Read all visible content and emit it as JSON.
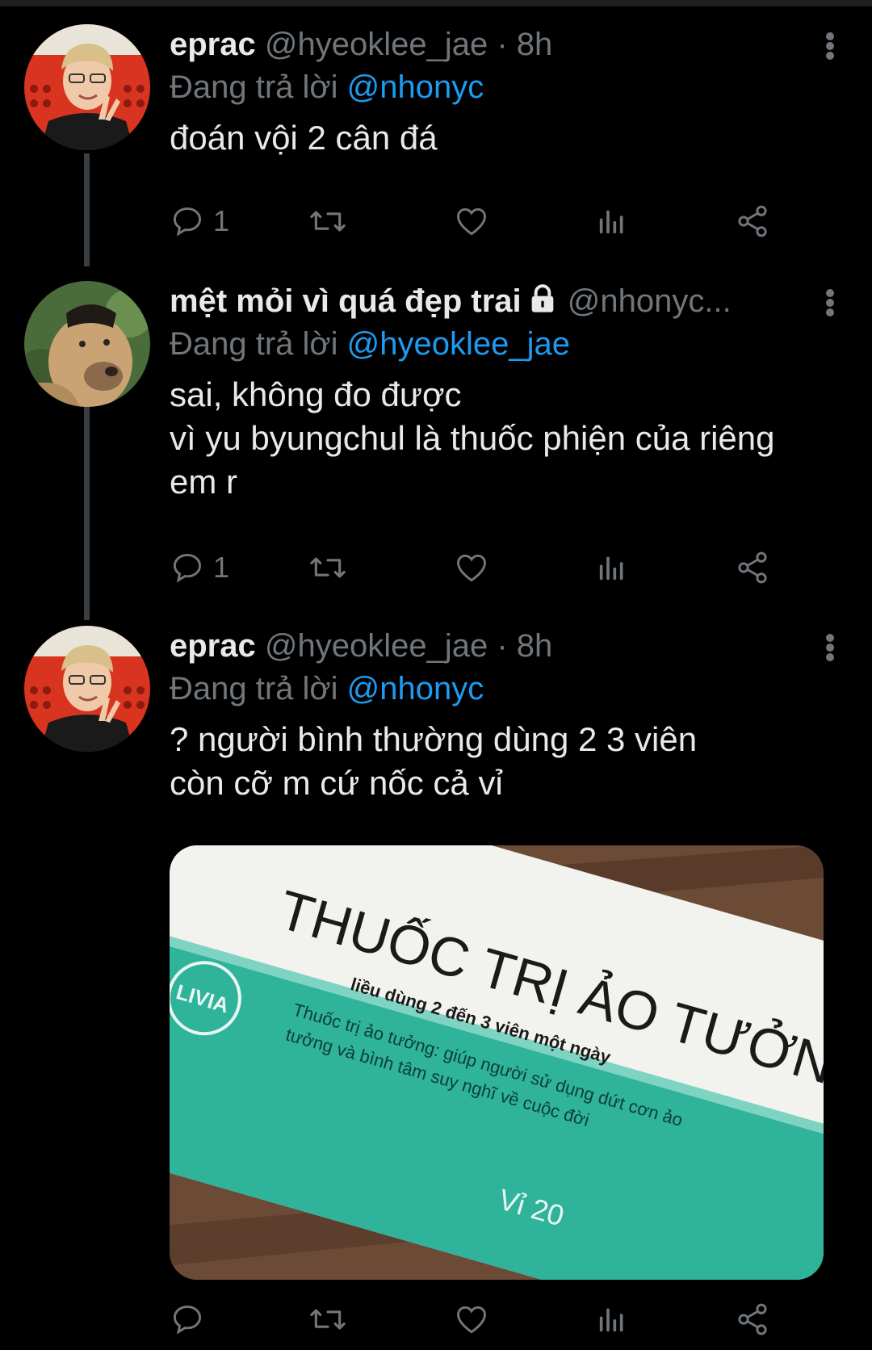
{
  "colors": {
    "background": "#000000",
    "text": "#e7e9ea",
    "muted": "#71767b",
    "link": "#1d9bf0"
  },
  "tweets": [
    {
      "name": "eprac",
      "handle": "@hyeoklee_jae",
      "time": "· 8h",
      "replying_label": "Đang trả lời",
      "replying_to": "@nhonyc",
      "text": "đoán vội 2 cân đá",
      "reply_count": "1"
    },
    {
      "name": "mệt mỏi vì quá đẹp trai",
      "handle": "@nhonyc...",
      "replying_label": "Đang trả lời",
      "replying_to": "@hyeoklee_jae",
      "text": "sai, không đo được\nvì yu byungchul là thuốc phiện của riêng\nem r",
      "reply_count": "1"
    },
    {
      "name": "eprac",
      "handle": "@hyeoklee_jae",
      "time": "· 8h",
      "replying_label": "Đang trả lời",
      "replying_to": "@nhonyc",
      "text": "? người bình thường dùng 2 3 viên\ncòn cỡ m cứ nốc cả vỉ",
      "reply_count": ""
    }
  ],
  "media": {
    "title": "THUỐC TRỊ ẢO TƯỞNG",
    "dosage": "liều dùng 2 đến 3 viên một ngày",
    "brand": "LIVIA",
    "description_line1": "Thuốc trị ảo tưởng: giúp người sử dụng dứt cơn ảo",
    "description_line2": "tưởng và bình tâm suy nghĩ về cuộc đời",
    "pack": "Vỉ 20"
  },
  "icons": [
    "reply-icon",
    "retweet-icon",
    "like-icon",
    "analytics-icon",
    "share-icon",
    "more-icon",
    "lock-icon"
  ]
}
